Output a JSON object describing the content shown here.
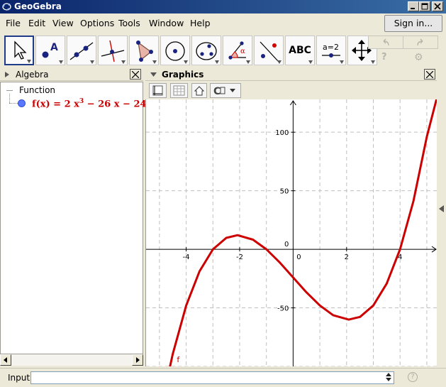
{
  "window": {
    "title": "GeoGebra",
    "buttons": [
      "minimize",
      "maximize",
      "close"
    ]
  },
  "menubar": {
    "items": [
      "File",
      "Edit",
      "View",
      "Options",
      "Tools",
      "Window",
      "Help"
    ],
    "sign_in_label": "Sign in..."
  },
  "toolbar": {
    "tools": [
      {
        "name": "move-tool-icon",
        "selected": true
      },
      {
        "name": "point-tool-icon"
      },
      {
        "name": "line-tool-icon"
      },
      {
        "name": "perpendicular-line-tool-icon"
      },
      {
        "name": "polygon-tool-icon"
      },
      {
        "name": "circle-center-point-tool-icon"
      },
      {
        "name": "conic-five-points-tool-icon"
      },
      {
        "name": "angle-tool-icon"
      },
      {
        "name": "reflect-tool-icon"
      },
      {
        "name": "text-tool-icon",
        "label": "ABC"
      },
      {
        "name": "slider-tool-icon",
        "label": "a=2"
      },
      {
        "name": "move-graphics-view-tool-icon"
      }
    ],
    "undo": "undo-icon",
    "redo": "redo-icon",
    "help_glyph": "?"
  },
  "algebra": {
    "title": "Algebra",
    "category": "Function",
    "items": [
      {
        "label": "f(x) = 2 x",
        "exponent": "3",
        "rest": " − 26 x − 24",
        "color": "#cc0000",
        "dot_color": "#5a78ff"
      }
    ]
  },
  "graphics": {
    "title": "Graphics",
    "curve_label": "f",
    "curve_color": "#cc0000",
    "x_ticks": [
      "-4",
      "-2",
      "0",
      "2",
      "4"
    ],
    "y_ticks": [
      "100",
      "50",
      "0",
      "-50"
    ]
  },
  "chart_data": {
    "type": "line",
    "title": "",
    "xlabel": "",
    "ylabel": "",
    "xlim": [
      -5.5,
      5.4
    ],
    "ylim": [
      -100,
      128
    ],
    "grid": true,
    "series": [
      {
        "name": "f",
        "function": "2x^3 - 26x - 24",
        "x": [
          -4.8,
          -4.5,
          -4.0,
          -3.5,
          -3.0,
          -2.5,
          -2.08,
          -1.5,
          -1.0,
          -0.5,
          0.0,
          0.5,
          1.0,
          1.5,
          2.08,
          2.5,
          3.0,
          3.5,
          4.0,
          4.5,
          5.0,
          5.4
        ],
        "y": [
          -120.4,
          -89.25,
          -48.0,
          -18.75,
          0.0,
          9.75,
          12.04,
          8.25,
          0.0,
          -11.25,
          -24.0,
          -36.75,
          -48.0,
          -56.25,
          -60.04,
          -57.75,
          -48.0,
          -29.25,
          0.0,
          41.25,
          96.0,
          131.4
        ]
      }
    ]
  },
  "inputbar": {
    "label": "Input:",
    "value": "",
    "help_glyph": "?"
  }
}
